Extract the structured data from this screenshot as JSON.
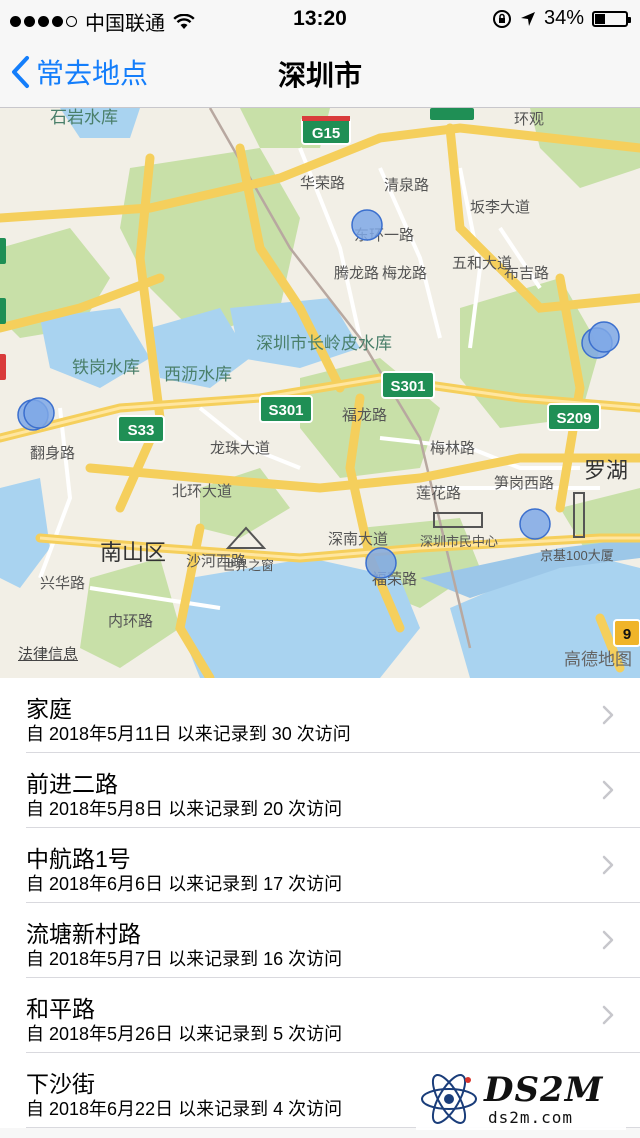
{
  "status_bar": {
    "carrier": "中国联通",
    "time": "13:20",
    "battery": "34%",
    "battery_level": 0.34,
    "icons": [
      "signal-dots",
      "wifi-icon",
      "rotation-lock-icon",
      "location-arrow-icon",
      "battery-icon"
    ]
  },
  "nav": {
    "back_label": "常去地点",
    "title": "深圳市"
  },
  "map": {
    "legal_link": "法律信息",
    "attribution": "高德地图",
    "labels": {
      "shiyan": "石岩水库",
      "tiegang": "铁岗水库",
      "xili": "西沥水库",
      "changlingpi": "深圳市长岭皮水库",
      "nanshan": "南山区",
      "luohu": "罗湖",
      "window": "世界之窗",
      "civic": "深圳市民中心",
      "kingkey": "京基100大厦",
      "longzhu": "龙珠大道",
      "beihuan": "北环大道",
      "shennan": "深南大道",
      "meilin": "梅林路",
      "lianhua": "莲花路",
      "sungang": "笋岗西路",
      "neihuan": "内环路",
      "shahexi": "沙河西路",
      "fanshen": "翻身路",
      "banli": "坂李大道",
      "wuhe": "五和大道",
      "qingquan": "清泉路",
      "huarong": "华荣路",
      "dongyi": "东环一路",
      "tenglong": "腾龙路",
      "meilong": "梅龙路",
      "huanlong": "环观",
      "buji": "布吉路",
      "fuhua": "福荣路",
      "tailong": "福龙路",
      "xinghua": "兴华路"
    },
    "shields": {
      "g15": "G15",
      "s33": "S33",
      "s301a": "S301",
      "s301b": "S301",
      "s209": "S209",
      "nine": "9"
    }
  },
  "places": [
    {
      "name": "家庭",
      "detail": "自 2018年5月11日 以来记录到 30 次访问"
    },
    {
      "name": "前进二路",
      "detail": "自 2018年5月8日 以来记录到 20 次访问"
    },
    {
      "name": "中航路1号",
      "detail": "自 2018年6月6日 以来记录到 17 次访问"
    },
    {
      "name": "流塘新村路",
      "detail": "自 2018年5月7日 以来记录到 16 次访问"
    },
    {
      "name": "和平路",
      "detail": "自 2018年5月26日 以来记录到 5 次访问"
    },
    {
      "name": "下沙街",
      "detail": "自 2018年6月22日 以来记录到 4 次访问"
    }
  ],
  "watermark": {
    "logo": "DS2M",
    "site": "ds2m.com"
  },
  "colors": {
    "accent": "#147efb",
    "pin_fill": "#7fa8e6",
    "pin_stroke": "#3b6fce",
    "road_major": "#f5cf5c",
    "green_area": "#c8e0a8",
    "water": "#a9d3f0",
    "shield_green": "#1f8f55"
  }
}
